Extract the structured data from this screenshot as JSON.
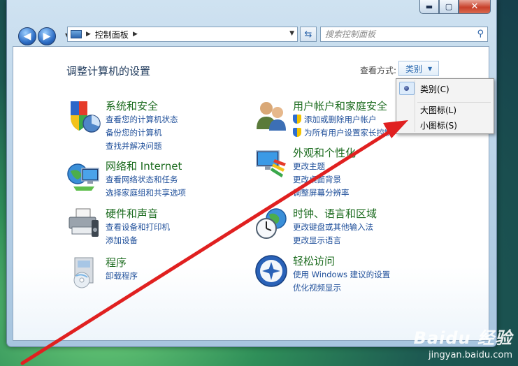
{
  "window": {
    "caption_buttons": {
      "minimize": "▬",
      "maximize": "▢",
      "close": "✕"
    }
  },
  "toolbar": {
    "back_icon": "back-arrow-icon",
    "forward_icon": "forward-arrow-icon",
    "breadcrumb": "控制面板",
    "search_placeholder": "搜索控制面板"
  },
  "header": {
    "title": "调整计算机的设置",
    "view_by_label": "查看方式:",
    "view_by_value": "类别"
  },
  "categories_left": [
    {
      "title": "系统和安全",
      "icon": "system-security-icon",
      "links": [
        "查看您的计算机状态",
        "备份您的计算机",
        "查找并解决问题"
      ]
    },
    {
      "title": "网络和 Internet",
      "icon": "network-internet-icon",
      "links": [
        "查看网络状态和任务",
        "选择家庭组和共享选项"
      ]
    },
    {
      "title": "硬件和声音",
      "icon": "hardware-sound-icon",
      "links": [
        "查看设备和打印机",
        "添加设备"
      ]
    },
    {
      "title": "程序",
      "icon": "programs-icon",
      "links": [
        "卸载程序"
      ]
    }
  ],
  "categories_right": [
    {
      "title": "用户帐户和家庭安全",
      "icon": "user-accounts-icon",
      "links": [
        "添加或删除用户帐户",
        "为所有用户设置家长控制"
      ]
    },
    {
      "title": "外观和个性化",
      "icon": "appearance-icon",
      "links": [
        "更改主题",
        "更改桌面背景",
        "调整屏幕分辨率"
      ]
    },
    {
      "title": "时钟、语言和区域",
      "icon": "clock-language-icon",
      "links": [
        "更改键盘或其他输入法",
        "更改显示语言"
      ]
    },
    {
      "title": "轻松访问",
      "icon": "ease-of-access-icon",
      "links": [
        "使用 Windows 建议的设置",
        "优化视频显示"
      ]
    }
  ],
  "view_menu": {
    "items": [
      {
        "label": "类别(C)",
        "checked": true
      },
      {
        "label": "大图标(L)",
        "checked": false
      },
      {
        "label": "小图标(S)",
        "checked": false
      }
    ]
  },
  "watermark": {
    "logo": "Baidu 经验",
    "url": "jingyan.baidu.com"
  },
  "colors": {
    "category_title": "#1b6b1e",
    "link": "#1f4f9a",
    "annotation_arrow": "#e02020"
  }
}
